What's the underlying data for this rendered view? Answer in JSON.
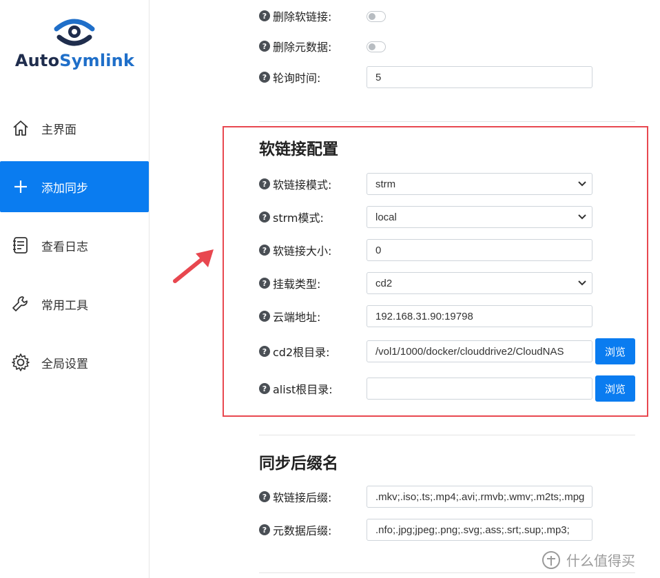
{
  "app": {
    "name_part1": "Auto",
    "name_part2": "Symlink"
  },
  "sidebar": {
    "items": [
      {
        "label": "主界面",
        "icon": "home-icon"
      },
      {
        "label": "添加同步",
        "icon": "plus-icon",
        "active": true
      },
      {
        "label": "查看日志",
        "icon": "log-icon"
      },
      {
        "label": "常用工具",
        "icon": "wrench-icon"
      },
      {
        "label": "全局设置",
        "icon": "gear-icon"
      }
    ]
  },
  "top_settings": {
    "delete_symlink": {
      "label": "删除软链接:",
      "enabled": false
    },
    "delete_metadata": {
      "label": "删除元数据:",
      "enabled": false
    },
    "poll_time": {
      "label": "轮询时间:",
      "value": "5"
    }
  },
  "symlink_config": {
    "title": "软链接配置",
    "mode": {
      "label": "软链接模式:",
      "value": "strm"
    },
    "strm_mode": {
      "label": "strm模式:",
      "value": "local"
    },
    "size": {
      "label": "软链接大小:",
      "value": "0"
    },
    "mount_type": {
      "label": "挂载类型:",
      "value": "cd2"
    },
    "cloud_addr": {
      "label": "云端地址:",
      "value": "192.168.31.90:19798"
    },
    "cd2_root": {
      "label": "cd2根目录:",
      "value": "/vol1/1000/docker/clouddrive2/CloudNAS",
      "browse": "浏览"
    },
    "alist_root": {
      "label": "alist根目录:",
      "value": "",
      "browse": "浏览"
    }
  },
  "sync_suffix": {
    "title": "同步后缀名",
    "symlink_suffix": {
      "label": "软链接后缀:",
      "value": ".mkv;.iso;.ts;.mp4;.avi;.rmvb;.wmv;.m2ts;.mpg"
    },
    "metadata_suffix": {
      "label": "元数据后缀:",
      "value": ".nfo;.jpg;jpeg;.png;.svg;.ass;.srt;.sup;.mp3;"
    }
  },
  "help_glyph": "?",
  "watermark": "什么值得买",
  "colors": {
    "primary": "#0a7cf0",
    "highlight_box": "#e8474f",
    "arrow": "#e8474f"
  }
}
